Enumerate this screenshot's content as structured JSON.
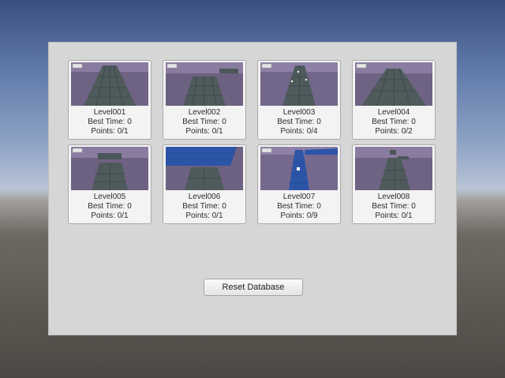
{
  "levels": [
    {
      "name": "Level001",
      "best_time": "Best Time: 0",
      "points": "Points: 0/1",
      "style": "purple"
    },
    {
      "name": "Level002",
      "best_time": "Best Time: 0",
      "points": "Points: 0/1",
      "style": "purple"
    },
    {
      "name": "Level003",
      "best_time": "Best Time: 0",
      "points": "Points: 0/4",
      "style": "purple"
    },
    {
      "name": "Level004",
      "best_time": "Best Time: 0",
      "points": "Points: 0/2",
      "style": "purple"
    },
    {
      "name": "Level005",
      "best_time": "Best Time: 0",
      "points": "Points: 0/1",
      "style": "purple"
    },
    {
      "name": "Level006",
      "best_time": "Best Time: 0",
      "points": "Points: 0/1",
      "style": "blue"
    },
    {
      "name": "Level007",
      "best_time": "Best Time: 0",
      "points": "Points: 0/9",
      "style": "blue"
    },
    {
      "name": "Level008",
      "best_time": "Best Time: 0",
      "points": "Points: 0/1",
      "style": "purple"
    }
  ],
  "reset_button": {
    "label": "Reset Database"
  },
  "colors": {
    "panel": "#d6d6d6",
    "card": "#f3f3f3",
    "thumb_purple": "#7a6a8e",
    "thumb_blue": "#2c55a8",
    "tile": "#4f5b5e"
  }
}
